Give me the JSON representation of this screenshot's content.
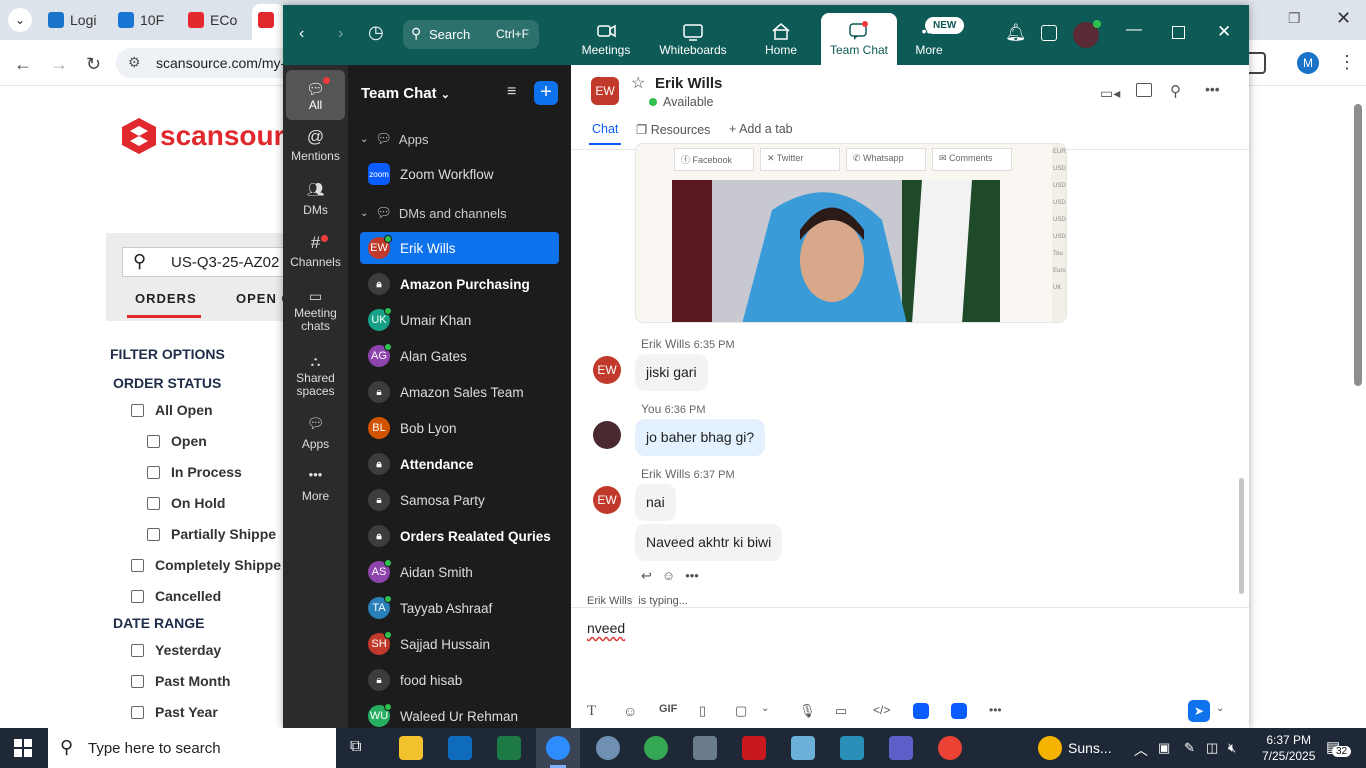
{
  "browser": {
    "tabs": [
      {
        "label": "Logi",
        "color": "#1a73c8"
      },
      {
        "label": "10F",
        "color": "#1976d2"
      },
      {
        "label": "ECo",
        "color": "#e0282d"
      }
    ],
    "url": "scansource.com/my-",
    "profile_initial": "M",
    "logo_text": "scansour",
    "order_search_value": "US-Q3-25-AZ02",
    "tab_orders": "ORDERS",
    "tab_open": "OPEN O",
    "filter_title": "FILTER OPTIONS",
    "order_status_title": "ORDER STATUS",
    "order_status": [
      "All Open",
      "Open",
      "In Process",
      "On Hold",
      "Partially Shippe",
      "Completely Shippe",
      "Cancelled"
    ],
    "date_range_title": "DATE RANGE",
    "date_range": [
      "Yesterday",
      "Past Month",
      "Past Year"
    ]
  },
  "zoom": {
    "search_label": "Search",
    "search_shortcut": "Ctrl+F",
    "tabs": [
      "Meetings",
      "Whiteboards",
      "Home",
      "Team Chat",
      "More"
    ],
    "new_badge": "NEW",
    "rail": [
      "All",
      "Mentions",
      "DMs",
      "Channels",
      "Meeting chats",
      "Shared spaces",
      "Apps",
      "More"
    ],
    "sidebar_title": "Team Chat",
    "section_apps": "Apps",
    "app_item": "Zoom Workflow",
    "app_logo": "zoom",
    "section_dms": "DMs and channels",
    "items": [
      {
        "label": "Erik Wills",
        "initials": "EW",
        "color": "#c0392b",
        "online": true,
        "lock": false,
        "bold": false,
        "selected": true
      },
      {
        "label": "Amazon Purchasing",
        "initials": "",
        "color": "#444",
        "online": false,
        "lock": true,
        "bold": true,
        "selected": false
      },
      {
        "label": "Umair Khan",
        "initials": "UK",
        "color": "#16a085",
        "online": true,
        "lock": false,
        "bold": false,
        "selected": false
      },
      {
        "label": "Alan Gates",
        "initials": "AG",
        "color": "#8e44ad",
        "online": true,
        "lock": false,
        "bold": false,
        "selected": false
      },
      {
        "label": "Amazon Sales Team",
        "initials": "",
        "color": "#444",
        "online": false,
        "lock": true,
        "bold": false,
        "selected": false
      },
      {
        "label": "Bob Lyon",
        "initials": "BL",
        "color": "#d35400",
        "online": false,
        "lock": false,
        "bold": false,
        "selected": false
      },
      {
        "label": "Attendance",
        "initials": "",
        "color": "#444",
        "online": false,
        "lock": true,
        "bold": true,
        "selected": false
      },
      {
        "label": "Samosa Party",
        "initials": "",
        "color": "#444",
        "online": false,
        "lock": true,
        "bold": false,
        "selected": false
      },
      {
        "label": "Orders Realated Quries",
        "initials": "",
        "color": "#444",
        "online": false,
        "lock": true,
        "bold": true,
        "selected": false
      },
      {
        "label": "Aidan Smith",
        "initials": "AS",
        "color": "#8e44ad",
        "online": true,
        "lock": false,
        "bold": false,
        "selected": false
      },
      {
        "label": "Tayyab Ashraaf",
        "initials": "TA",
        "color": "#2980b9",
        "online": true,
        "lock": false,
        "bold": false,
        "selected": false
      },
      {
        "label": "Sajjad Hussain",
        "initials": "SH",
        "color": "#c0392b",
        "online": true,
        "lock": false,
        "bold": false,
        "selected": false
      },
      {
        "label": "food hisab",
        "initials": "",
        "color": "#444",
        "online": false,
        "lock": true,
        "bold": false,
        "selected": false
      },
      {
        "label": "Waleed Ur Rehman",
        "initials": "WU",
        "color": "#27ae60",
        "online": true,
        "lock": false,
        "bold": false,
        "selected": false
      }
    ],
    "chat": {
      "contact_name": "Erik Wills",
      "contact_initials": "EW",
      "status": "Available",
      "subtabs": [
        "Chat",
        "Resources",
        "Add a tab"
      ],
      "share_labels": [
        "Facebook",
        "Twitter",
        "Whatsapp",
        "Comments"
      ],
      "messages": [
        {
          "sender": "Erik Wills",
          "time": "6:35 PM",
          "texts": [
            "jiski gari"
          ]
        },
        {
          "sender": "You",
          "time": "6:36 PM",
          "texts": [
            "jo baher bhag gi?"
          ]
        },
        {
          "sender": "Erik Wills",
          "time": "6:37 PM",
          "texts": [
            "nai",
            "Naveed akhtr ki biwi"
          ]
        }
      ],
      "typing_name": "Erik Wills",
      "typing_suffix": "is typing...",
      "draft": "nveed",
      "gif_label": "GIF"
    }
  },
  "taskbar": {
    "search_placeholder": "Type here to search",
    "weather": "Suns...",
    "time": "6:37 PM",
    "date": "7/25/2025",
    "notifications": "32"
  }
}
